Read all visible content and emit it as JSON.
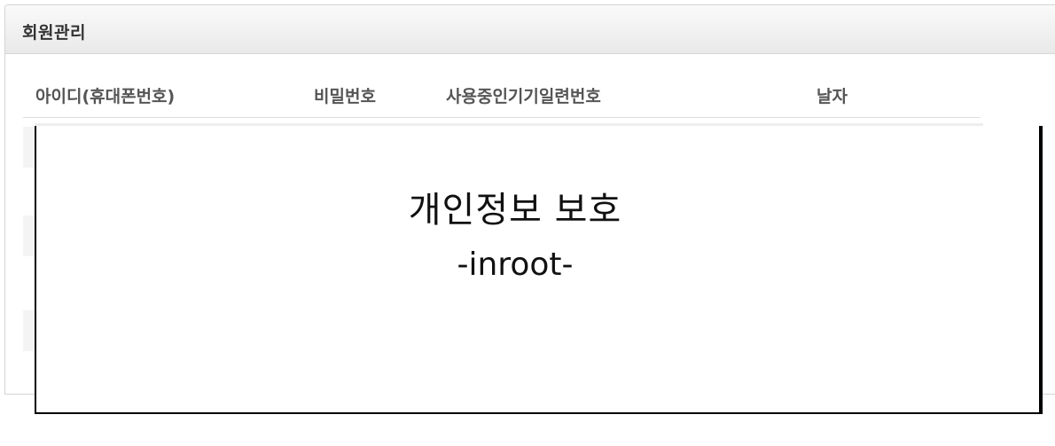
{
  "panel": {
    "title": "회원관리"
  },
  "table": {
    "columns": [
      "아이디(휴대폰번호)",
      "비밀번호",
      "사용중인기기일련번호",
      "날자"
    ]
  },
  "overlay": {
    "title": "개인정보 보호",
    "subtitle": "-inroot-"
  }
}
